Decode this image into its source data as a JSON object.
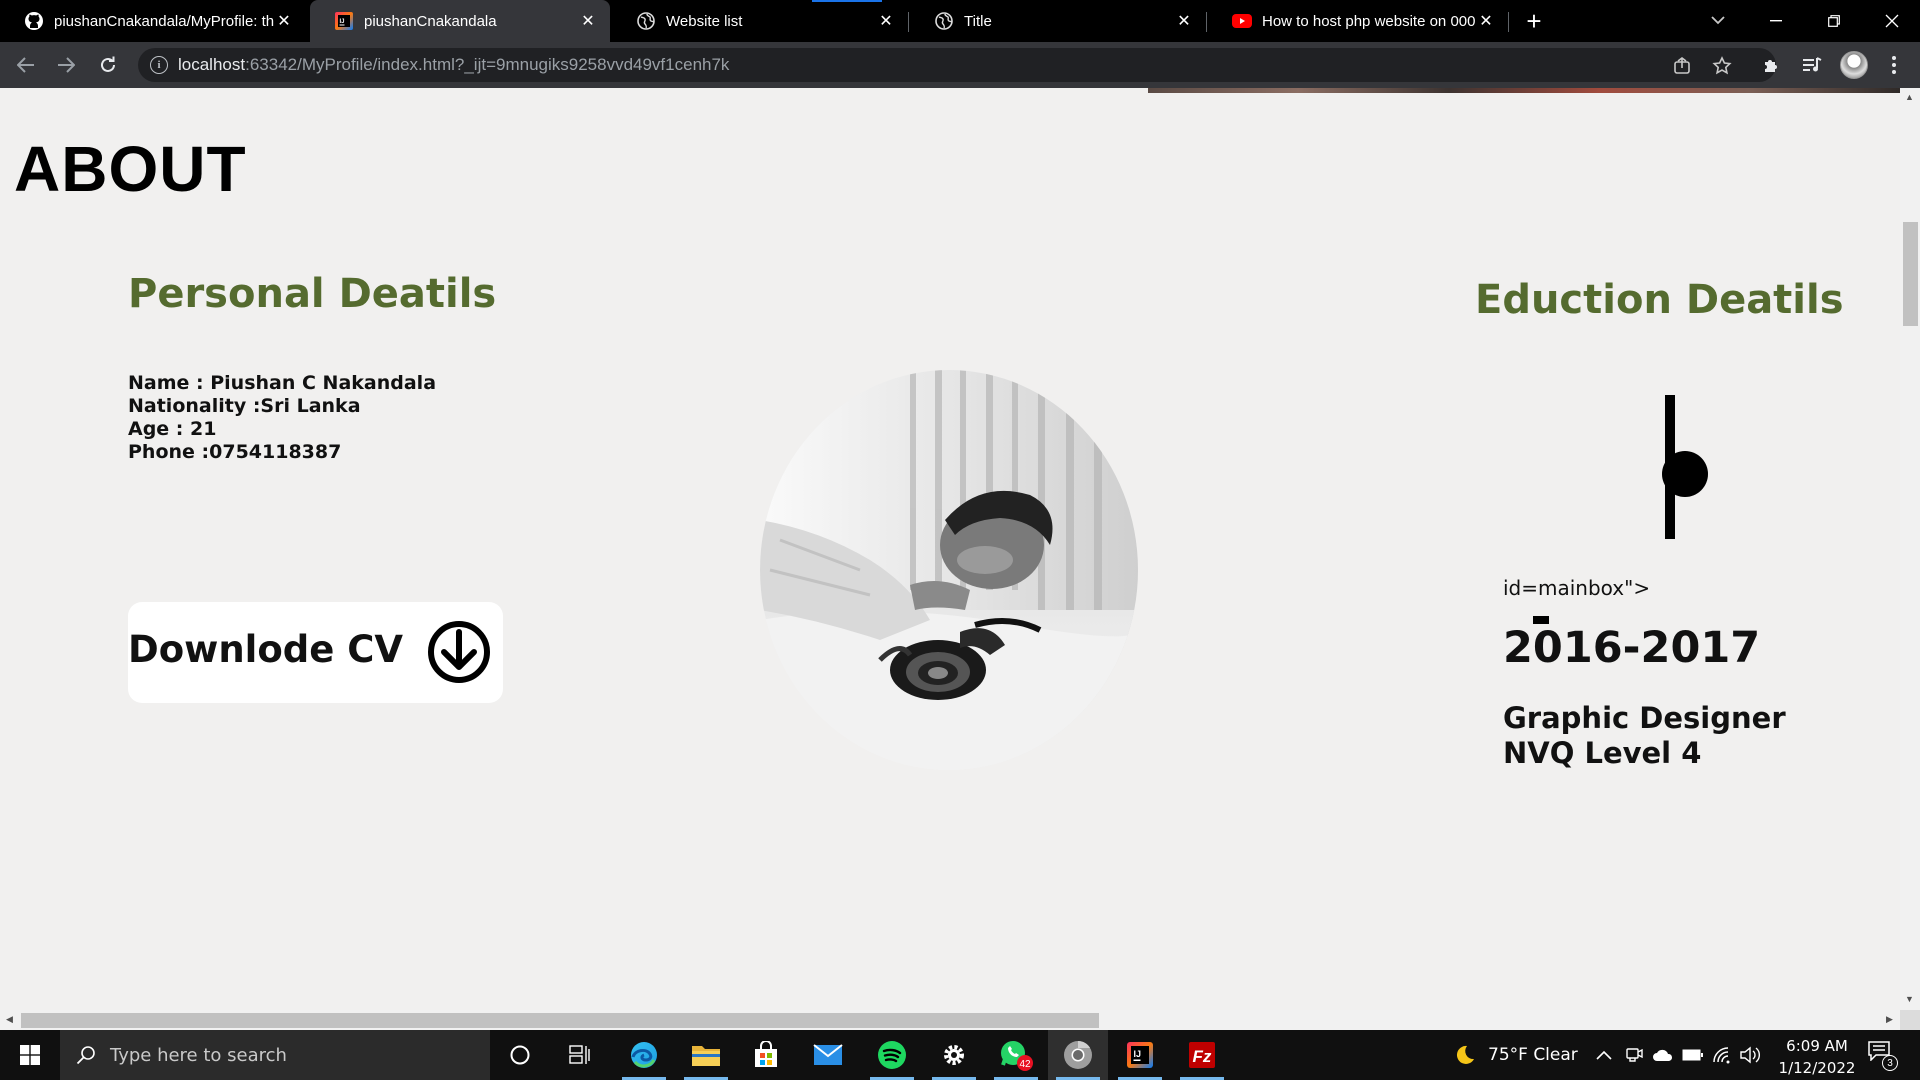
{
  "browser": {
    "tabs": [
      {
        "title": "piushanCnakandala/MyProfile: th",
        "icon": "github-icon"
      },
      {
        "title": "piushanCnakandala",
        "icon": "intellij-icon",
        "active": true
      },
      {
        "title": "Website list",
        "icon": "globe-icon"
      },
      {
        "title": "Title",
        "icon": "globe-icon"
      },
      {
        "title": "How to host php website on 000",
        "icon": "youtube-icon"
      }
    ],
    "url_host": "localhost",
    "url_rest": ":63342/MyProfile/index.html?_ijt=9mnugiks9258vvd49vf1cenh7k"
  },
  "page": {
    "about_title": "ABOUT",
    "personal_heading": "Personal Deatils",
    "education_heading": "Eduction Deatils",
    "details": [
      "Name : Piushan C Nakandala",
      "Nationality :Sri Lanka",
      "Age : 21",
      "Phone :0754118387"
    ],
    "cv_button": "Downlode CV",
    "stray_text": "id=mainbox\">",
    "education": {
      "years": "2016-2017",
      "line1": "Graphic Designer",
      "line2": "NVQ Level 4"
    }
  },
  "taskbar": {
    "search_placeholder": "Type here to search",
    "whatsapp_badge": "42",
    "weather": "75°F  Clear",
    "time": "6:09 AM",
    "date": "1/12/2022",
    "notifications": "3"
  },
  "colors": {
    "heading_green": "#556b2f",
    "page_bg": "#f1f0ef",
    "chrome_dark": "#35363a"
  }
}
